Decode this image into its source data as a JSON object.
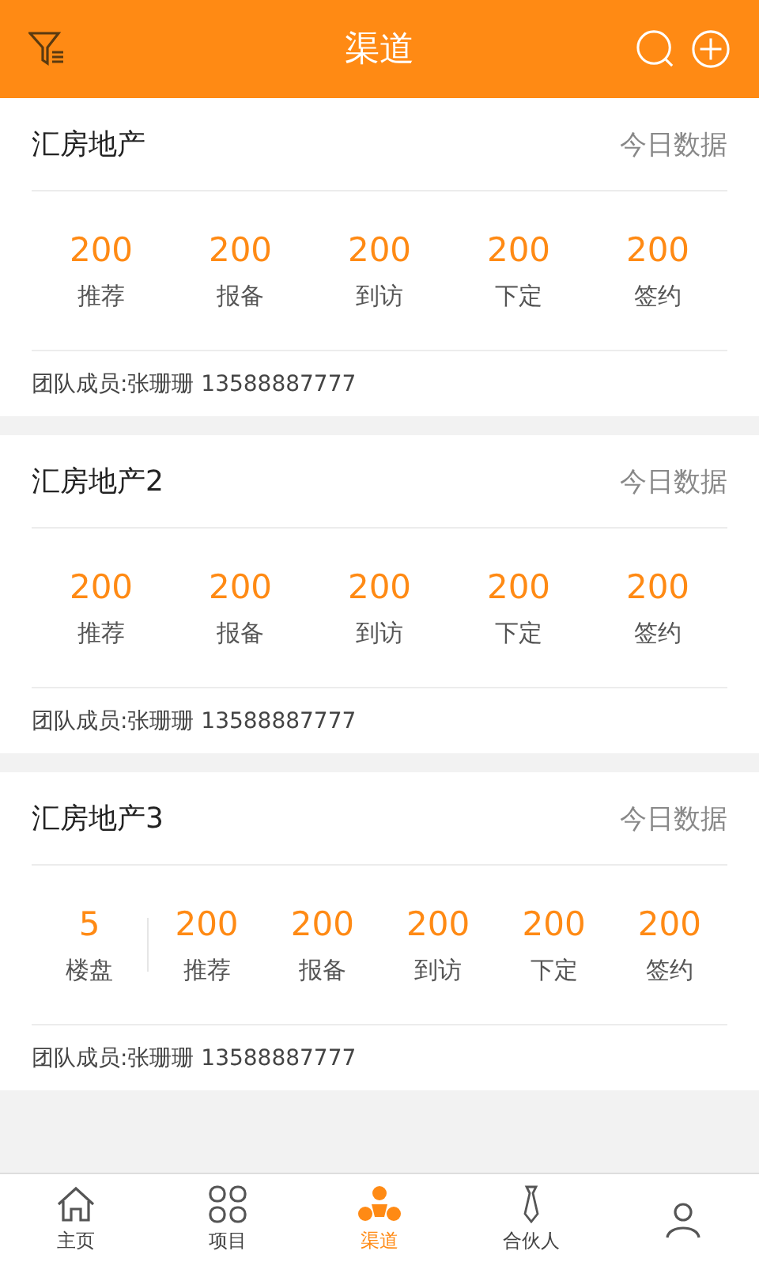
{
  "header": {
    "title": "渠道"
  },
  "cards": [
    {
      "name": "汇房地产",
      "right_label": "今日数据",
      "stats": [
        {
          "value": "200",
          "label": "推荐"
        },
        {
          "value": "200",
          "label": "报备"
        },
        {
          "value": "200",
          "label": "到访"
        },
        {
          "value": "200",
          "label": "下定"
        },
        {
          "value": "200",
          "label": "签约"
        }
      ],
      "members": "团队成员:张珊珊 13588887777"
    },
    {
      "name": "汇房地产2",
      "right_label": "今日数据",
      "stats": [
        {
          "value": "200",
          "label": "推荐"
        },
        {
          "value": "200",
          "label": "报备"
        },
        {
          "value": "200",
          "label": "到访"
        },
        {
          "value": "200",
          "label": "下定"
        },
        {
          "value": "200",
          "label": "签约"
        }
      ],
      "members": "团队成员:张珊珊 13588887777"
    },
    {
      "name": "汇房地产3",
      "right_label": "今日数据",
      "summary": {
        "value": "5",
        "label": "楼盘"
      },
      "stats": [
        {
          "value": "200",
          "label": "推荐"
        },
        {
          "value": "200",
          "label": "报备"
        },
        {
          "value": "200",
          "label": "到访"
        },
        {
          "value": "200",
          "label": "下定"
        },
        {
          "value": "200",
          "label": "签约"
        }
      ],
      "members": "团队成员:张珊珊 13588887777"
    }
  ],
  "tabs": [
    {
      "kind": "home",
      "label": "主页",
      "selected": false
    },
    {
      "kind": "grid",
      "label": "项目",
      "selected": false
    },
    {
      "kind": "channel",
      "label": "渠道",
      "selected": true
    },
    {
      "kind": "tie",
      "label": "合伙人",
      "selected": false
    },
    {
      "kind": "person",
      "selected": false
    }
  ]
}
